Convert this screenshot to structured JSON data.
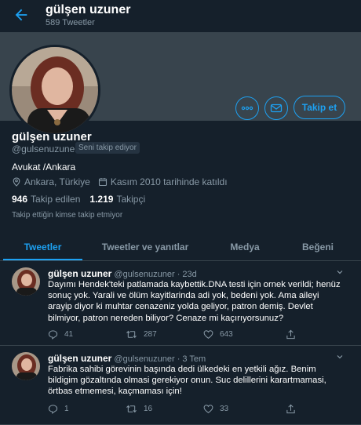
{
  "header": {
    "back_icon": "arrow-left-icon",
    "name": "gülşen uzuner",
    "tweet_count": "589 Tweetler"
  },
  "profile": {
    "name": "gülşen uzuner",
    "handle": "@gulsenuzuner",
    "follows_you_badge": "Seni takip ediyor",
    "bio": "Avukat /Ankara",
    "location": "Ankara, Türkiye",
    "joined": "Kasım 2010 tarihinde katıldı",
    "following_count": "946",
    "following_label": "Takip edilen",
    "followers_count": "1.219",
    "followers_label": "Takipçi",
    "followed_by_note": "Takip ettiğin kimse takip etmiyor",
    "follow_button": "Takip et",
    "more_icon": "more-icon",
    "message_icon": "mail-icon"
  },
  "tabs": [
    {
      "label": "Tweetler",
      "active": true
    },
    {
      "label": "Tweetler ve yanıtlar",
      "active": false
    },
    {
      "label": "Medya",
      "active": false
    },
    {
      "label": "Beğeni",
      "active": false
    }
  ],
  "tweets": [
    {
      "author": "gülşen uzuner",
      "handle": "@gulsenuzuner",
      "separator": "·",
      "time": "23d",
      "text": "Dayımı Hendek'teki patlamada kaybettik.DNA testi için ornek verildi; henüz sonuç yok. Yarali ve ölüm kayitlarinda adi yok, bedeni yok. Ama aileyi arayip diyor ki muhtar cenazeniz yolda geliyor, patron demiş. Devlet bilmiyor, patron nereden biliyor? Cenaze mi kaçırıyorsunuz?",
      "replies": "41",
      "retweets": "287",
      "likes": "643"
    },
    {
      "author": "gülşen uzuner",
      "handle": "@gulsenuzuner",
      "separator": "·",
      "time": "3 Tem",
      "text": "Fabrika sahibi görevinin başında dedi ülkedeki en yetkili ağız. Benim bildigim gözaltında olmasi gerekiyor onun. Suc delillerini karartmamasi, örtbas etmemesi, kaçmaması için!",
      "replies": "1",
      "retweets": "16",
      "likes": "33"
    }
  ],
  "colors": {
    "background": "#15202b",
    "accent": "#1da1f2",
    "muted": "#8899a6",
    "banner": "#38444d"
  }
}
